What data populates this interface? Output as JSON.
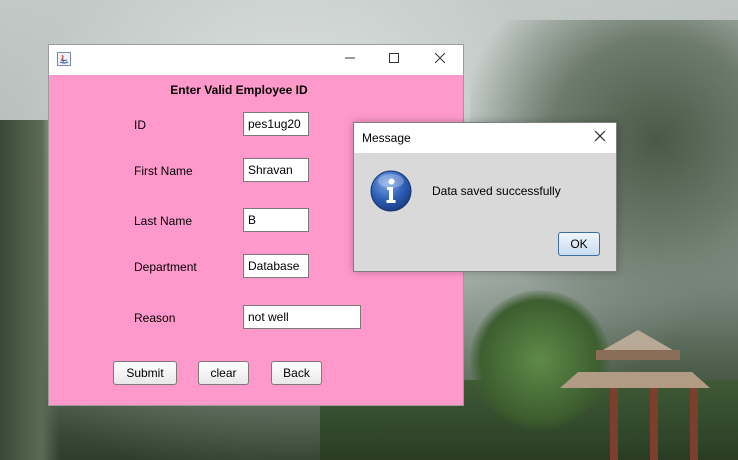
{
  "main_window": {
    "form_title": "Enter Valid Employee ID",
    "fields": [
      {
        "label": "ID",
        "value": "pes1ug20"
      },
      {
        "label": "First Name",
        "value": "Shravan"
      },
      {
        "label": "Last Name",
        "value": "B"
      },
      {
        "label": "Department",
        "value": "Database"
      },
      {
        "label": "Reason",
        "value": "not well"
      }
    ],
    "buttons": {
      "submit": "Submit",
      "clear": "clear",
      "back": "Back"
    },
    "background_color": "#ff99cc"
  },
  "message_dialog": {
    "title": "Message",
    "message": "Data saved successfully",
    "ok_label": "OK",
    "icon": "info-icon"
  },
  "titlebar_icons": {
    "app": "java-icon",
    "minimize": "minimize-icon",
    "maximize": "maximize-icon",
    "close": "close-icon"
  }
}
